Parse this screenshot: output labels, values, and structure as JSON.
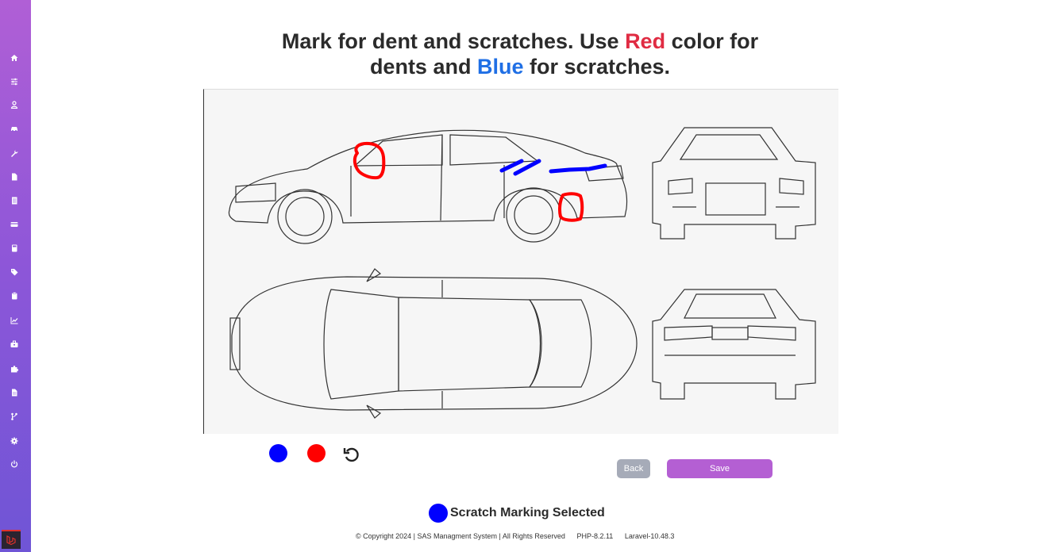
{
  "sidebar": {
    "items": [
      {
        "icon": "home-icon"
      },
      {
        "icon": "sliders-icon"
      },
      {
        "icon": "user-icon"
      },
      {
        "icon": "car-icon"
      },
      {
        "icon": "wrench-icon"
      },
      {
        "icon": "file-icon"
      },
      {
        "icon": "document-icon"
      },
      {
        "icon": "credit-card-icon"
      },
      {
        "icon": "calculator-icon"
      },
      {
        "icon": "tag-icon"
      },
      {
        "icon": "clipboard-icon"
      },
      {
        "icon": "chart-line-icon"
      },
      {
        "icon": "briefcase-icon"
      },
      {
        "icon": "puzzle-icon"
      },
      {
        "icon": "file-text-icon"
      },
      {
        "icon": "branch-icon"
      },
      {
        "icon": "gear-icon"
      },
      {
        "icon": "power-icon"
      }
    ],
    "logo": "laravel-logo-icon"
  },
  "header": {
    "part1": "Mark for dent and scratches. Use ",
    "red_word": "Red",
    "part2": " color for",
    "part3": "dents and ",
    "blue_word": "Blue",
    "part4": " for scratches."
  },
  "colors": {
    "red": "#ff0000",
    "blue": "#0000ff",
    "accent": "#b45fd3",
    "title_red": "#e02c43",
    "title_blue": "#1f6fe5"
  },
  "controls": {
    "blue_label": "Blue color",
    "red_label": "Red color",
    "undo_icon": "undo-icon"
  },
  "buttons": {
    "back": "Back",
    "save": "Save"
  },
  "status": {
    "text": "Scratch Marking Selected"
  },
  "footer": {
    "copyright": "© Copyright 2024 | SAS Managment System | All Rights Reserved",
    "php": "PHP-8.2.11",
    "laravel": "Laravel-10.48.3"
  }
}
